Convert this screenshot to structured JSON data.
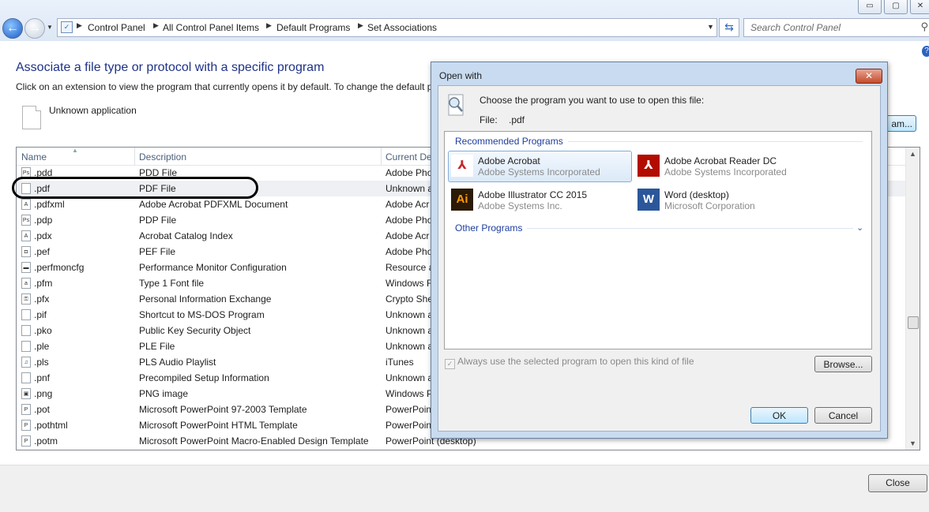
{
  "window": {
    "minimize": "▭",
    "maximize": "▢",
    "close": "✕"
  },
  "address": {
    "crumbs": [
      "Control Panel",
      "All Control Panel Items",
      "Default Programs",
      "Set Associations"
    ],
    "search_placeholder": "Search Control Panel"
  },
  "page": {
    "title": "Associate a file type or protocol with a specific program",
    "description": "Click on an extension to view the program that currently opens it by default. To change the default p",
    "current_program": "Unknown application",
    "change_button": "am...",
    "close_button": "Close"
  },
  "table": {
    "columns": [
      "Name",
      "Description",
      "Current De"
    ],
    "rows": [
      {
        "name": ".pdd",
        "desc": "PDD File",
        "current": "Adobe Pho",
        "icon": "Ps"
      },
      {
        "name": ".pdf",
        "desc": "PDF File",
        "current": "Unknown a",
        "icon": ""
      },
      {
        "name": ".pdfxml",
        "desc": "Adobe Acrobat PDFXML Document",
        "current": "Adobe Acr",
        "icon": "A"
      },
      {
        "name": ".pdp",
        "desc": "PDP File",
        "current": "Adobe Pho",
        "icon": "Ps"
      },
      {
        "name": ".pdx",
        "desc": "Acrobat Catalog Index",
        "current": "Adobe Acr",
        "icon": "A"
      },
      {
        "name": ".pef",
        "desc": "PEF File",
        "current": "Adobe Pho",
        "icon": "◘"
      },
      {
        "name": ".perfmoncfg",
        "desc": "Performance Monitor Configuration",
        "current": "Resource a",
        "icon": "▬"
      },
      {
        "name": ".pfm",
        "desc": "Type 1 Font file",
        "current": "Windows F",
        "icon": "a"
      },
      {
        "name": ".pfx",
        "desc": "Personal Information Exchange",
        "current": "Crypto She",
        "icon": "⚿"
      },
      {
        "name": ".pif",
        "desc": "Shortcut to MS-DOS Program",
        "current": "Unknown a",
        "icon": ""
      },
      {
        "name": ".pko",
        "desc": "Public Key Security Object",
        "current": "Unknown a",
        "icon": ""
      },
      {
        "name": ".ple",
        "desc": "PLE File",
        "current": "Unknown a",
        "icon": ""
      },
      {
        "name": ".pls",
        "desc": "PLS Audio Playlist",
        "current": "iTunes",
        "icon": "♫"
      },
      {
        "name": ".pnf",
        "desc": "Precompiled Setup Information",
        "current": "Unknown a",
        "icon": ""
      },
      {
        "name": ".png",
        "desc": "PNG image",
        "current": "Windows P",
        "icon": "▣"
      },
      {
        "name": ".pot",
        "desc": "Microsoft PowerPoint 97-2003 Template",
        "current": "PowerPoin",
        "icon": "P"
      },
      {
        "name": ".pothtml",
        "desc": "Microsoft PowerPoint HTML Template",
        "current": "PowerPoin",
        "icon": "P"
      },
      {
        "name": ".potm",
        "desc": "Microsoft PowerPoint Macro-Enabled Design Template",
        "current": "PowerPoint (desktop)",
        "icon": "P"
      }
    ]
  },
  "dialog": {
    "title": "Open with",
    "close": "✕",
    "prompt": "Choose the program you want to use to open this file:",
    "file_label": "File:",
    "file_value": ".pdf",
    "recommended_header": "Recommended Programs",
    "other_header": "Other Programs",
    "programs": [
      {
        "name": "Adobe Acrobat",
        "vendor": "Adobe Systems Incorporated",
        "icon": "acrobat-icon",
        "glyph": "⅄",
        "color": "#c8242b",
        "bg": "#ffffff",
        "selected": true
      },
      {
        "name": "Adobe Acrobat Reader DC",
        "vendor": "Adobe Systems Incorporated",
        "icon": "acrobat-reader-icon",
        "glyph": "⅄",
        "color": "#ffffff",
        "bg": "#b30b00",
        "selected": false
      },
      {
        "name": "Adobe Illustrator CC 2015",
        "vendor": "Adobe Systems Inc.",
        "icon": "illustrator-icon",
        "glyph": "Ai",
        "color": "#ff9a00",
        "bg": "#2b1a05",
        "selected": false
      },
      {
        "name": "Word (desktop)",
        "vendor": "Microsoft Corporation",
        "icon": "word-icon",
        "glyph": "W",
        "color": "#ffffff",
        "bg": "#2b579a",
        "selected": false
      }
    ],
    "always_use": "Always use the selected program to open this kind of file",
    "browse_button": "Browse...",
    "ok_button": "OK",
    "cancel_button": "Cancel"
  }
}
